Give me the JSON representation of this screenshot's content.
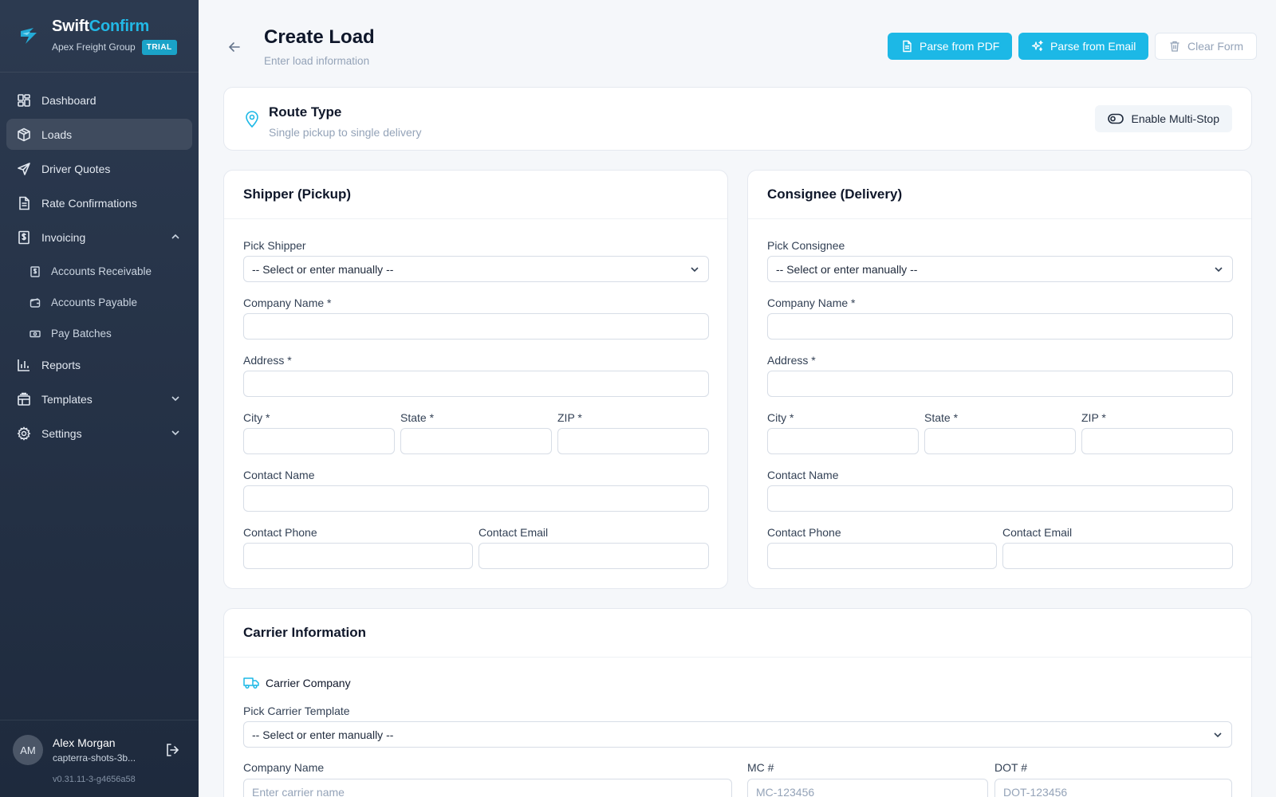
{
  "brand": {
    "name_part1": "Swift",
    "name_part2": "Confirm",
    "org": "Apex Freight Group",
    "badge": "TRIAL"
  },
  "sidebar": {
    "items": [
      {
        "label": "Dashboard",
        "icon": "grid-icon"
      },
      {
        "label": "Loads",
        "icon": "box-icon",
        "active": true
      },
      {
        "label": "Driver Quotes",
        "icon": "send-icon"
      },
      {
        "label": "Rate Confirmations",
        "icon": "document-icon"
      },
      {
        "label": "Invoicing",
        "icon": "invoice-icon",
        "expanded": true
      },
      {
        "label": "Reports",
        "icon": "bar-chart-icon"
      },
      {
        "label": "Templates",
        "icon": "templates-icon"
      },
      {
        "label": "Settings",
        "icon": "gear-icon"
      }
    ],
    "sub_items": [
      {
        "label": "Accounts Receivable",
        "icon": "receivable-icon"
      },
      {
        "label": "Accounts Payable",
        "icon": "wallet-icon"
      },
      {
        "label": "Pay Batches",
        "icon": "banknote-icon"
      }
    ]
  },
  "user": {
    "initials": "AM",
    "name": "Alex Morgan",
    "account": "capterra-shots-3b...",
    "version": "v0.31.11-3-g4656a58"
  },
  "header": {
    "title": "Create Load",
    "subtitle": "Enter load information",
    "parse_pdf": "Parse from PDF",
    "parse_email": "Parse from Email",
    "clear": "Clear Form"
  },
  "route": {
    "title": "Route Type",
    "subtitle": "Single pickup to single delivery",
    "multistop": "Enable Multi-Stop"
  },
  "shipper": {
    "title": "Shipper (Pickup)",
    "pick_label": "Pick Shipper",
    "pick_value": "-- Select or enter manually --",
    "company": "Company Name *",
    "address": "Address *",
    "city": "City *",
    "state": "State *",
    "zip": "ZIP *",
    "contact_name": "Contact Name",
    "contact_phone": "Contact Phone",
    "contact_email": "Contact Email"
  },
  "consignee": {
    "title": "Consignee (Delivery)",
    "pick_label": "Pick Consignee",
    "pick_value": "-- Select or enter manually --",
    "company": "Company Name *",
    "address": "Address *",
    "city": "City *",
    "state": "State *",
    "zip": "ZIP *",
    "contact_name": "Contact Name",
    "contact_phone": "Contact Phone",
    "contact_email": "Contact Email"
  },
  "carrier": {
    "title": "Carrier Information",
    "company_section": "Carrier Company",
    "template_label": "Pick Carrier Template",
    "template_value": "-- Select or enter manually --",
    "company_label": "Company Name",
    "company_placeholder": "Enter carrier name",
    "mc_label": "MC #",
    "mc_placeholder": "MC-123456",
    "dot_label": "DOT #",
    "dot_placeholder": "DOT-123456"
  },
  "colors": {
    "accent": "#1cb8e6",
    "sidebar_bg": "#27344a",
    "active_item": "#3f4b5e"
  }
}
